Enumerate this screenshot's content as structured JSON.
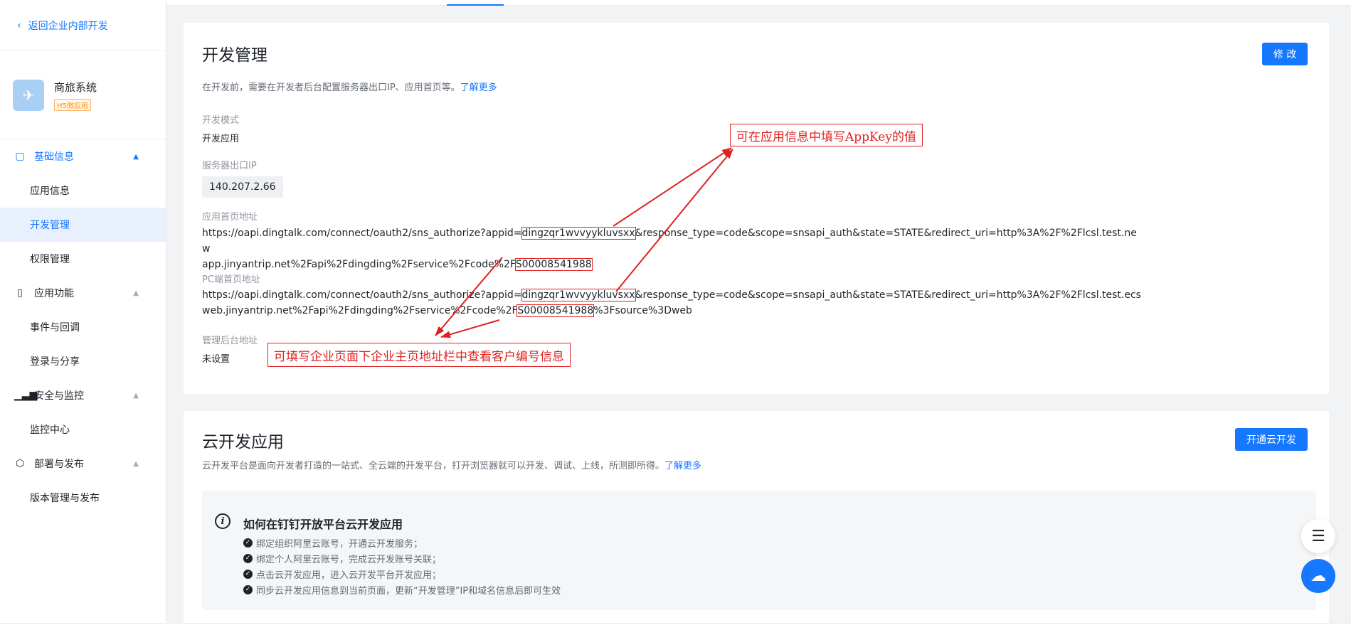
{
  "sidebar": {
    "back_label": "返回企业内部开发",
    "app_name": "商旅系统",
    "app_tag": "H5微应用",
    "groups": [
      {
        "label": "基础信息",
        "items": [
          "应用信息",
          "开发管理",
          "权限管理"
        ]
      },
      {
        "label": "应用功能",
        "items": [
          "事件与回调",
          "登录与分享"
        ]
      },
      {
        "label": "安全与监控",
        "items": [
          "监控中心"
        ]
      },
      {
        "label": "部署与发布",
        "items": [
          "版本管理与发布"
        ]
      }
    ]
  },
  "dev": {
    "title": "开发管理",
    "desc": "在开发前，需要在开发者后台配置服务器出口IP、应用首页等。",
    "more": "了解更多",
    "edit_button": "修 改",
    "mode_label": "开发模式",
    "mode_value": "开发应用",
    "ip_label": "服务器出口IP",
    "ip_value": "140.207.2.66",
    "home_label": "应用首页地址",
    "home_url": {
      "p1": "https://oapi.dingtalk.com/connect/oauth2/sns_authorize?appid=",
      "appid": "dingzqr1wvvyykluvsxx",
      "p2": "&response_type=code&scope=snsapi_auth&state=STATE&redirect_uri=http%3A%2F%2Flcsl.test.new",
      "p3": "app.jinyantrip.net%2Fapi%2Fdingding%2Fservice%2Fcode%2F",
      "cust": "S00008541988"
    },
    "pc_label": "PC端首页地址",
    "pc_url": {
      "p1": "https://oapi.dingtalk.com/connect/oauth2/sns_authorize?appid=",
      "appid": "dingzqr1wvvyykluvsxx",
      "p2": "&response_type=code&scope=snsapi_auth&state=STATE&redirect_uri=http%3A%2F%2Flcsl.test.ecs",
      "p3": "web.jinyantrip.net%2Fapi%2Fdingding%2Fservice%2Fcode%2F",
      "cust": "S00008541988",
      "p4": "%3Fsource%3Dweb"
    },
    "admin_label": "管理后台地址",
    "admin_value": "未设置"
  },
  "annotations": {
    "appkey_note": "可在应用信息中填写AppKey的值",
    "customer_note": "可填写企业页面下企业主页地址栏中查看客户编号信息"
  },
  "cloud": {
    "title": "云开发应用",
    "desc": "云开发平台是面向开发者打造的一站式、全云端的开发平台，打开浏览器就可以开发、调试、上线，所测即所得。",
    "more": "了解更多",
    "open_button": "开通云开发",
    "guide_title": "如何在钉钉开放平台云开发应用",
    "steps": [
      "绑定组织阿里云账号，开通云开发服务；",
      "绑定个人阿里云账号，完成云开发账号关联；",
      "点击云开发应用，进入云开发平台开发应用；",
      "同步云开发应用信息到当前页面，更新“开发管理”IP和域名信息后即可生效"
    ]
  },
  "colors": {
    "primary": "#1677ff",
    "annotation_red": "#e02020"
  }
}
